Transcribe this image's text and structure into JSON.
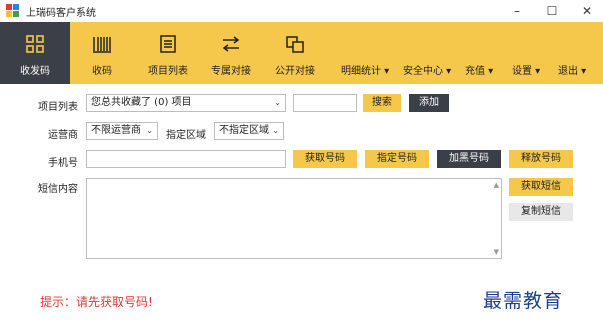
{
  "window": {
    "title": "上瑞码客户系统",
    "minimize": "–",
    "maximize": "☐",
    "close": "✕"
  },
  "toolbar": {
    "nav": [
      {
        "label": "收发码",
        "icon": "grid-icon",
        "active": true
      },
      {
        "label": "收码",
        "icon": "barcode-icon",
        "active": false
      },
      {
        "label": "项目列表",
        "icon": "list-icon",
        "active": false
      },
      {
        "label": "专属对接",
        "icon": "swap-icon",
        "active": false
      },
      {
        "label": "公开对接",
        "icon": "link-icon",
        "active": false
      }
    ],
    "menus": [
      {
        "label": "明细统计 ▾"
      },
      {
        "label": "安全中心 ▾"
      },
      {
        "label": "充值 ▾"
      },
      {
        "label": "设置 ▾"
      },
      {
        "label": "退出 ▾"
      }
    ]
  },
  "form": {
    "project_label": "项目列表",
    "project_select": "您总共收藏了 (0) 项目",
    "search_button": "搜索",
    "add_button": "添加",
    "carrier_label": "运营商",
    "carrier_select": "不限运营商",
    "region_label": "指定区域",
    "region_select": "不指定区域",
    "phone_label": "手机号",
    "get_number_button": "获取号码",
    "specify_number_button": "指定号码",
    "blacklist_button": "加黑号码",
    "release_number_button": "释放号码",
    "sms_label": "短信内容",
    "get_sms_button": "获取短信",
    "copy_sms_button": "复制短信",
    "caret": "⌄"
  },
  "hint": "提示：请先获取号码!",
  "watermark": "最需教育",
  "colors": {
    "accent": "#f5c84c",
    "dark": "#3b3f47",
    "hint": "#e53935",
    "watermark": "#1d3f8f"
  }
}
